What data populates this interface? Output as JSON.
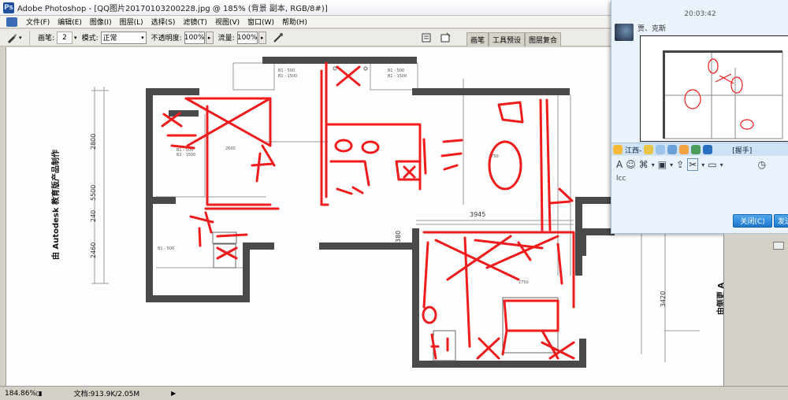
{
  "window": {
    "title": "Adobe Photoshop - [QQ图片20170103200228.jpg @ 185% (背景 副本, RGB/8#)]",
    "logo_text": "Ps"
  },
  "menu": {
    "items": [
      "文件(F)",
      "编辑(E)",
      "图像(I)",
      "图层(L)",
      "选择(S)",
      "滤镜(T)",
      "视图(V)",
      "窗口(W)",
      "帮助(H)"
    ]
  },
  "options": {
    "brush_label": "画笔:",
    "brush_size": "2",
    "mode_label": "模式:",
    "mode_value": "正常",
    "opacity_label": "不透明度:",
    "opacity_value": "100%",
    "flow_label": "流量:",
    "flow_value": "100%"
  },
  "palette_well": {
    "tabs": [
      "画笔",
      "工具预设",
      "图层复合"
    ]
  },
  "status": {
    "zoom": "184.86%",
    "doc": "文档:913.9K/2.05M"
  },
  "chat": {
    "time": "20:03:42",
    "sender": "贾、克斯",
    "contact_label": "江西-",
    "shake_label": "[握手]",
    "input_text": "lcc",
    "close_label": "关闭(C)",
    "send_label": "发送"
  },
  "drawing": {
    "side_text": "由 Autodesk 教育版产品制作",
    "side_text_right": "由侧更 A",
    "dims": [
      "2800",
      "5500",
      "240",
      "2460",
      "3945",
      "380",
      "3420"
    ],
    "small_labels": [
      "B1 - 500",
      "B1 - 1500",
      "B1 - 500",
      "B1 - 1500",
      "B1 - 500",
      "B2 - 1500",
      "B1 - 500",
      "2600",
      "2750",
      "2750"
    ]
  },
  "colors": {
    "markup": "#ee1c1c",
    "walls": "#4a4a4a",
    "chat_bg": "#eaf3fb",
    "button_blue": "#1e77cc"
  }
}
